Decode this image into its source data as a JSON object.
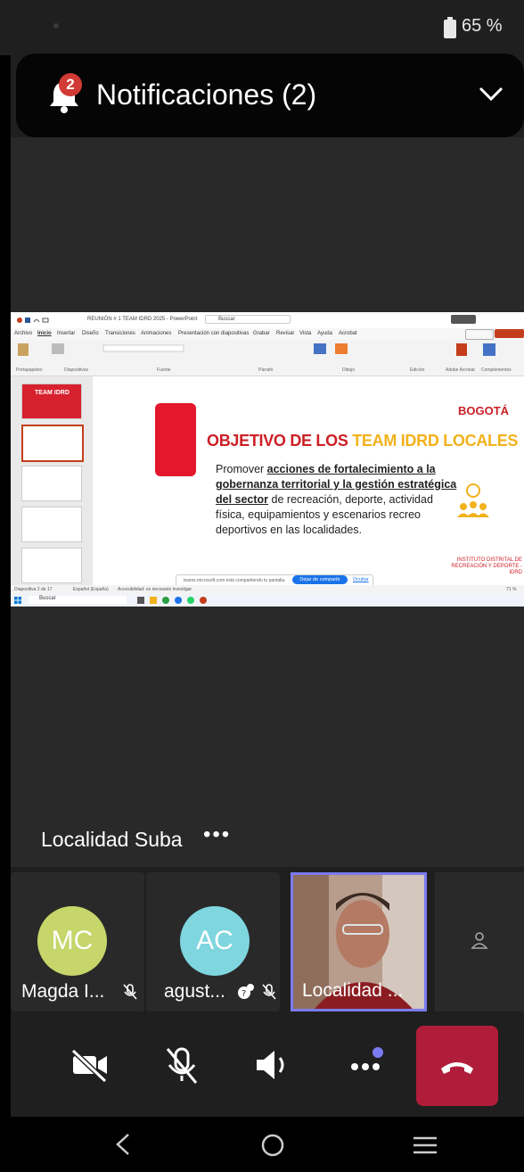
{
  "status_bar": {
    "battery": "65 %"
  },
  "notification": {
    "badge": "2",
    "title": "Notificaciones (2)"
  },
  "shared_screen": {
    "window_title": "REUNIÓN # 1 TEAM IDRD 2025 - PowerPoint",
    "search": "Buscar",
    "menu": [
      "Archivo",
      "Inicio",
      "Insertar",
      "Diseño",
      "Transiciones",
      "Animaciones",
      "Presentación con diapositivas",
      "Grabar",
      "Revisar",
      "Vista",
      "Ayuda",
      "Acrobat"
    ],
    "ribbon_groups": [
      "Portapapeles",
      "Diapositivas",
      "Fuente",
      "Párrafo",
      "Dibujo",
      "Edición",
      "Adobe Acrobat",
      "Complementos"
    ],
    "slide_title_a": "OBJETIVO DE LOS ",
    "slide_title_b": "TEAM IDRD LOCALES",
    "slide_body_1": "Promover ",
    "slide_body_bold": "acciones de fortalecimiento a la gobernanza territorial y la gestión estratégica del sector",
    "slide_body_2": " de recreación, deporte, actividad física, equipamientos y escenarios recreo deportivos en las localidades.",
    "brand": "BOGOTÁ",
    "institute": "INSTITUTO DISTRITAL DE RECREACIÓN Y DEPORTE - IDRD",
    "share_bar_text": "teams.microsoft.com está compartiendo tu pantalla.",
    "stop_sharing": "Dejar de compartir",
    "hide": "Ocultar",
    "status_left": "Diapositiva 2 de 17",
    "status_lang": "Español (España)",
    "status_access": "Accesibilidad: es necesario investigar",
    "taskbar_search": "Buscar",
    "zoom": "71 %",
    "tile_text": "TEAM IDRD"
  },
  "stage": {
    "label": "Localidad Suba",
    "more": "•••"
  },
  "participants": [
    {
      "initials": "MC",
      "name": "Magda I...",
      "color": "#c6d66a"
    },
    {
      "initials": "AC",
      "name": "agust...",
      "color": "#7fd6df"
    },
    {
      "initials": "",
      "name": "Localidad ..."
    }
  ],
  "colors": {
    "end_call": "#b01d3b",
    "active_border": "#7b7bf0"
  }
}
